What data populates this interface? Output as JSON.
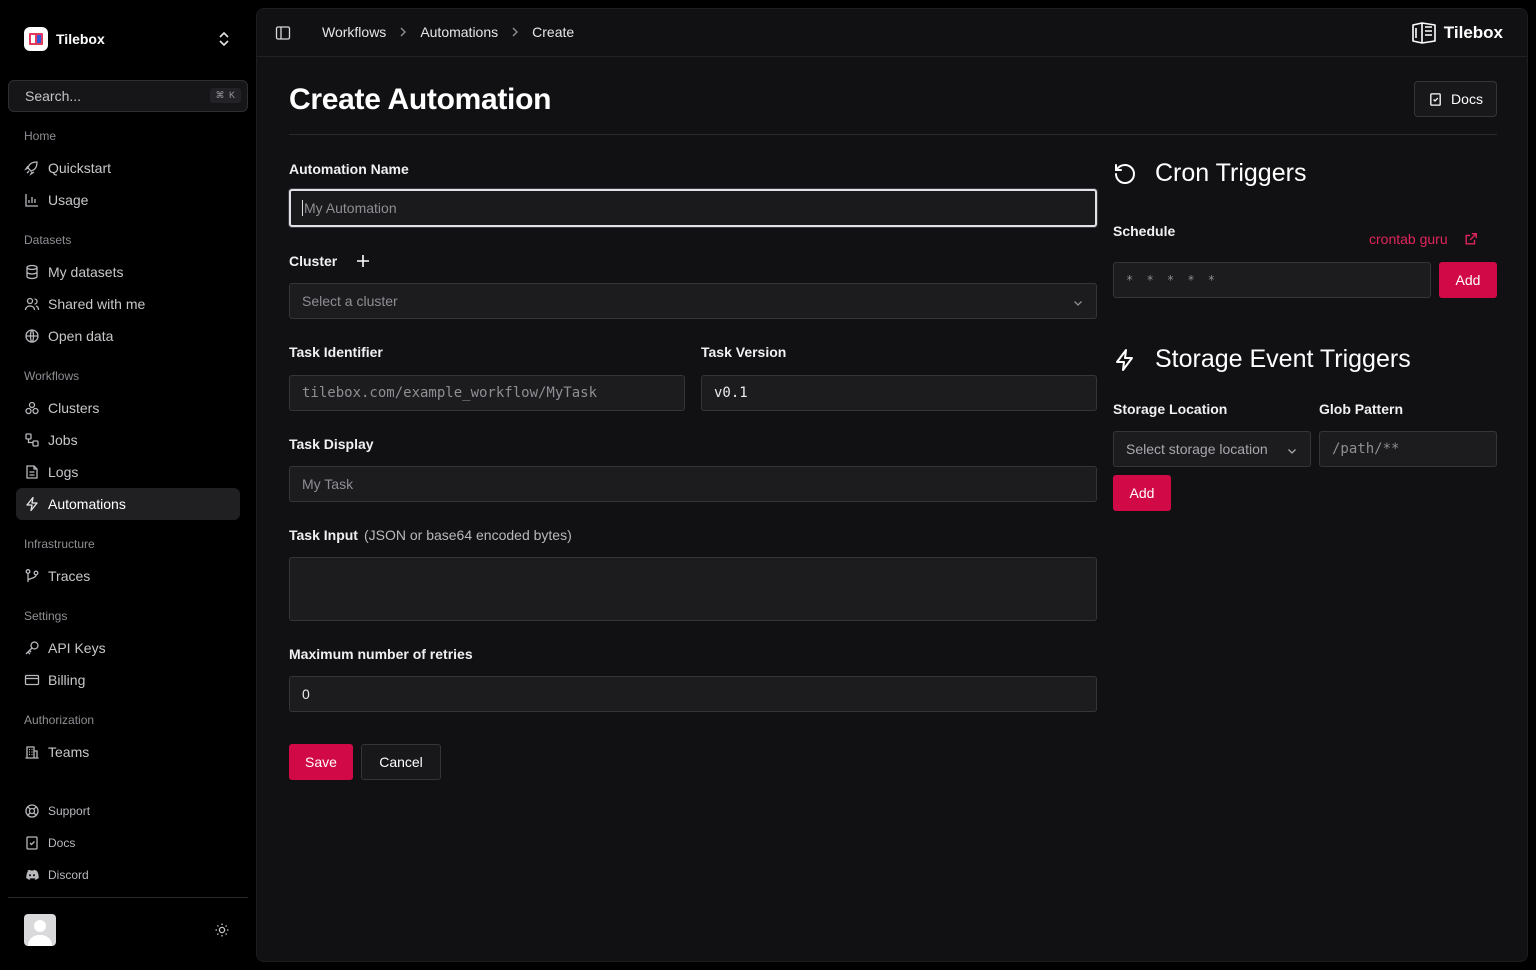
{
  "org": {
    "name": "Tilebox"
  },
  "search": {
    "placeholder": "Search...",
    "shortcut": "⌘ K"
  },
  "sidebar": {
    "sections": [
      {
        "title": "Home",
        "items": [
          "Quickstart",
          "Usage"
        ]
      },
      {
        "title": "Datasets",
        "items": [
          "My datasets",
          "Shared with me",
          "Open data"
        ]
      },
      {
        "title": "Workflows",
        "items": [
          "Clusters",
          "Jobs",
          "Logs",
          "Automations"
        ]
      },
      {
        "title": "Infrastructure",
        "items": [
          "Traces"
        ]
      },
      {
        "title": "Settings",
        "items": [
          "API Keys",
          "Billing"
        ]
      },
      {
        "title": "Authorization",
        "items": [
          "Teams"
        ]
      }
    ],
    "footer": [
      "Support",
      "Docs",
      "Discord"
    ],
    "active_item": "Automations"
  },
  "breadcrumb": [
    "Workflows",
    "Automations",
    "Create"
  ],
  "brand": "Tilebox",
  "page": {
    "title": "Create Automation",
    "docs_label": "Docs"
  },
  "form": {
    "automation_name": {
      "label": "Automation Name",
      "placeholder": "My Automation"
    },
    "cluster": {
      "label": "Cluster",
      "placeholder": "Select a cluster"
    },
    "task_identifier": {
      "label": "Task Identifier",
      "placeholder": "tilebox.com/example_workflow/MyTask"
    },
    "task_version": {
      "label": "Task Version",
      "value": "v0.1"
    },
    "task_display": {
      "label": "Task Display",
      "placeholder": "My Task"
    },
    "task_input": {
      "label": "Task Input",
      "hint": "(JSON or base64 encoded bytes)"
    },
    "max_retries": {
      "label": "Maximum number of retries",
      "value": "0"
    },
    "save_label": "Save",
    "cancel_label": "Cancel"
  },
  "cron": {
    "title": "Cron Triggers",
    "schedule_label": "Schedule",
    "link_label": "crontab guru",
    "schedule_placeholder": "* * * * *",
    "add_label": "Add"
  },
  "storage": {
    "title": "Storage Event Triggers",
    "location_label": "Storage Location",
    "location_placeholder": "Select storage location",
    "glob_label": "Glob Pattern",
    "glob_placeholder": "/path/**",
    "add_label": "Add"
  },
  "colors": {
    "accent": "#d10a47",
    "link": "#e0255c",
    "background": "#111113"
  }
}
